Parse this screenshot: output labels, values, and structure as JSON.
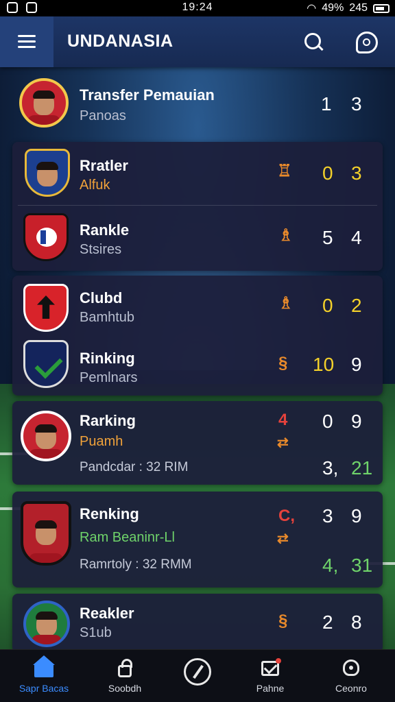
{
  "status_bar": {
    "time": "19:24",
    "battery": "49%",
    "signal": "245"
  },
  "app": {
    "title": "UNDANASIA"
  },
  "featured": {
    "name": "Transfer Pemauian",
    "sub": "Panoas",
    "score_a": "1",
    "score_b": "3"
  },
  "groups": [
    {
      "items": [
        {
          "name": "Rratler",
          "sub": "Alfuk",
          "sub_style": "orange",
          "score_a": "0",
          "score_b": "3",
          "score_color": "yellow"
        },
        {
          "name": "Rankle",
          "sub": "Stsires",
          "score_a": "5",
          "score_b": "4"
        }
      ]
    },
    {
      "items": [
        {
          "name": "Clubd",
          "sub": "Bamhtub",
          "score_a": "0",
          "score_b": "2",
          "score_color": "yellow"
        },
        {
          "name": "Rinking",
          "sub": "Pemlnars",
          "score_a": "10",
          "score_b": "9",
          "score_color": "yellow"
        }
      ]
    },
    {
      "items": [
        {
          "name": "Rarking",
          "sub": "Puamh",
          "sub_style": "orange",
          "detail": "Pandcdar : 32 RIM",
          "pos_marker": "4",
          "score_a": "0",
          "score_b": "9",
          "score_a2": "3,",
          "score_b2": "21"
        }
      ]
    },
    {
      "items": [
        {
          "name": "Renking",
          "sub": "Ram Beaninr-Ll",
          "sub_style": "green",
          "detail": "Ramrtoly : 32 RMM",
          "pos_marker": "C,",
          "score_a": "3",
          "score_b": "9",
          "score_a2": "4,",
          "score_b2": "31"
        }
      ]
    },
    {
      "items": [
        {
          "name": "Reakler",
          "sub": "S1ub",
          "score_a": "2",
          "score_b": "8"
        }
      ]
    }
  ],
  "bottom_nav": [
    {
      "label": "Sapr Bacas",
      "icon": "home-icon",
      "active": true
    },
    {
      "label": "Soobdh",
      "icon": "lock-icon"
    },
    {
      "label": "",
      "icon": "compass-icon"
    },
    {
      "label": "Pahne",
      "icon": "mail-icon"
    },
    {
      "label": "Ceonro",
      "icon": "bell-icon"
    }
  ],
  "colors": {
    "accent": "#3b8cff",
    "score_highlight": "#f4d12a",
    "score_green": "#6fd36a",
    "card_bg": "#1c1e3a"
  }
}
